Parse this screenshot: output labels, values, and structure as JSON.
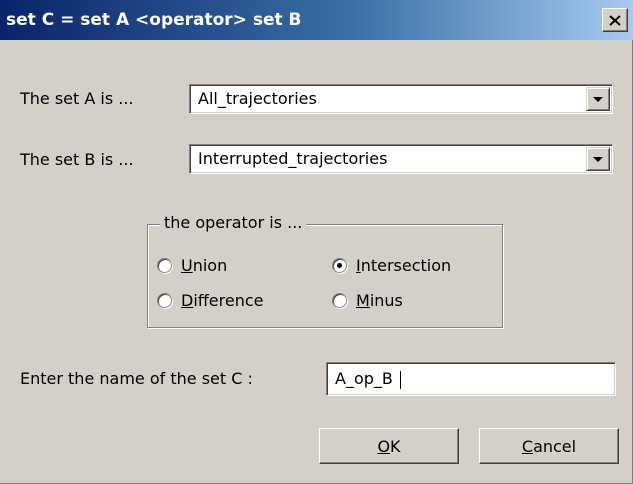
{
  "window": {
    "title": "set C = set A <operator> set B",
    "close_icon": "close-x-icon"
  },
  "setA": {
    "label": "The set A is ...",
    "value": "All_trajectories",
    "dropdown_icon": "chevron-down-icon"
  },
  "setB": {
    "label": "The set B is ...",
    "value": "Interrupted_trajectories",
    "dropdown_icon": "chevron-down-icon"
  },
  "operator": {
    "legend": "the operator is ...",
    "options": [
      {
        "pre": "",
        "mnemonic": "U",
        "post": "nion",
        "checked": false
      },
      {
        "pre": "",
        "mnemonic": "I",
        "post": "ntersection",
        "checked": true
      },
      {
        "pre": "",
        "mnemonic": "D",
        "post": "ifference",
        "checked": false
      },
      {
        "pre": "",
        "mnemonic": "M",
        "post": "inus",
        "checked": false
      }
    ]
  },
  "setC": {
    "label": "Enter the name of the set C :",
    "value": "A_op_B "
  },
  "buttons": {
    "ok": {
      "pre": "",
      "mnemonic": "O",
      "post": "K"
    },
    "cancel": {
      "pre": "",
      "mnemonic": "C",
      "post": "ancel"
    }
  }
}
